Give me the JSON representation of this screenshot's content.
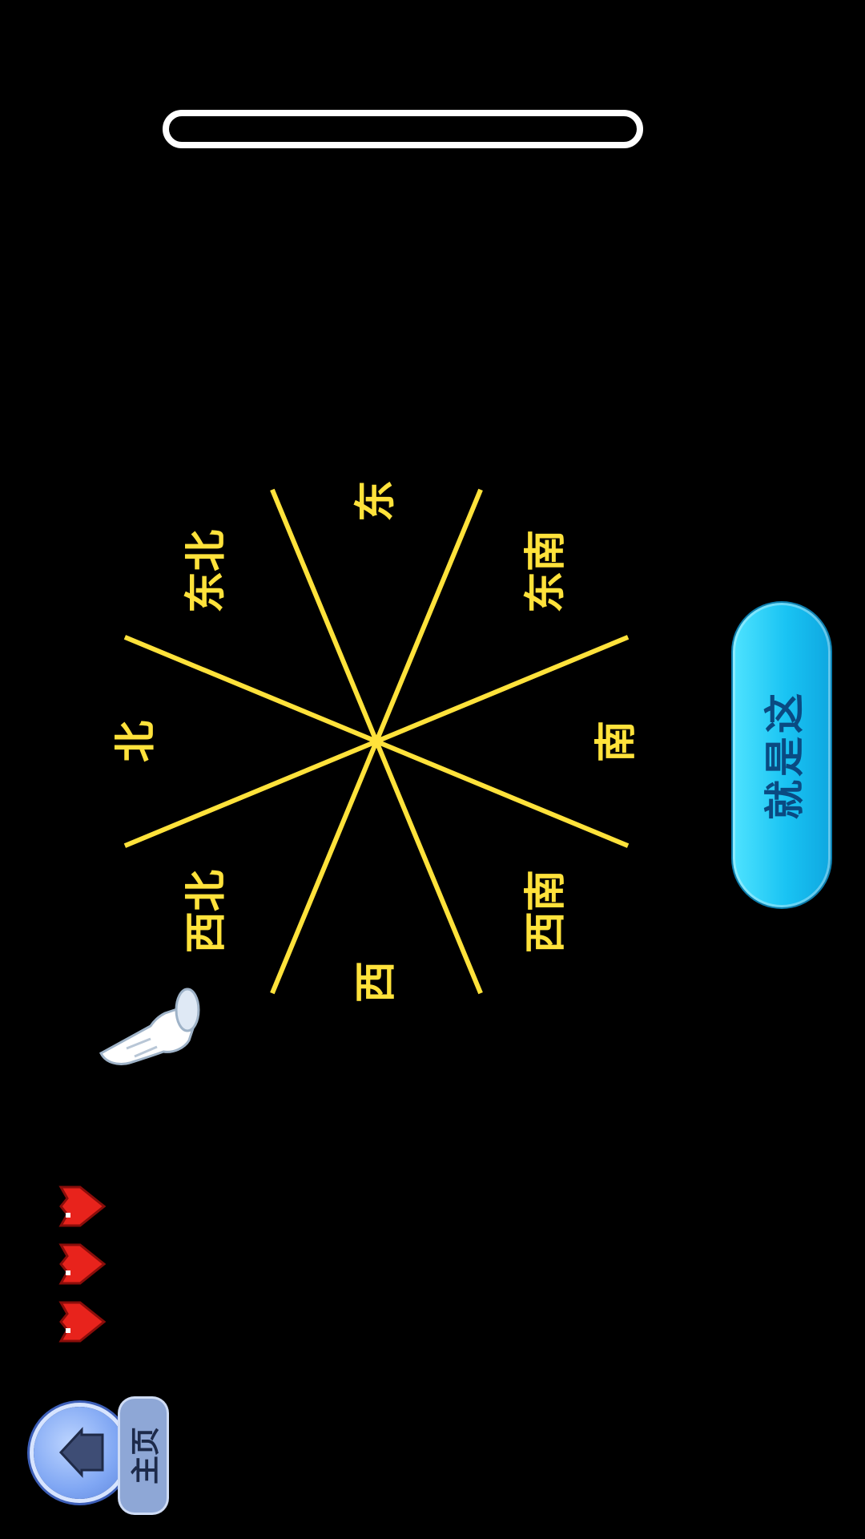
{
  "progress": {
    "value": 0
  },
  "compass": {
    "directions": [
      "东",
      "东南",
      "南",
      "西南",
      "西",
      "西北",
      "北",
      "东北"
    ]
  },
  "confirm_button": {
    "label": "就是这"
  },
  "lives": {
    "count": 3
  },
  "home": {
    "label": "主页"
  },
  "colors": {
    "wheel_line": "#ffe23b",
    "label": "#ffe23b",
    "confirm": "#19c3f3",
    "heart": "#e8231c"
  },
  "icons": {
    "pointer": "pointing-hand-icon",
    "home": "house-icon",
    "heart": "heart-icon"
  }
}
